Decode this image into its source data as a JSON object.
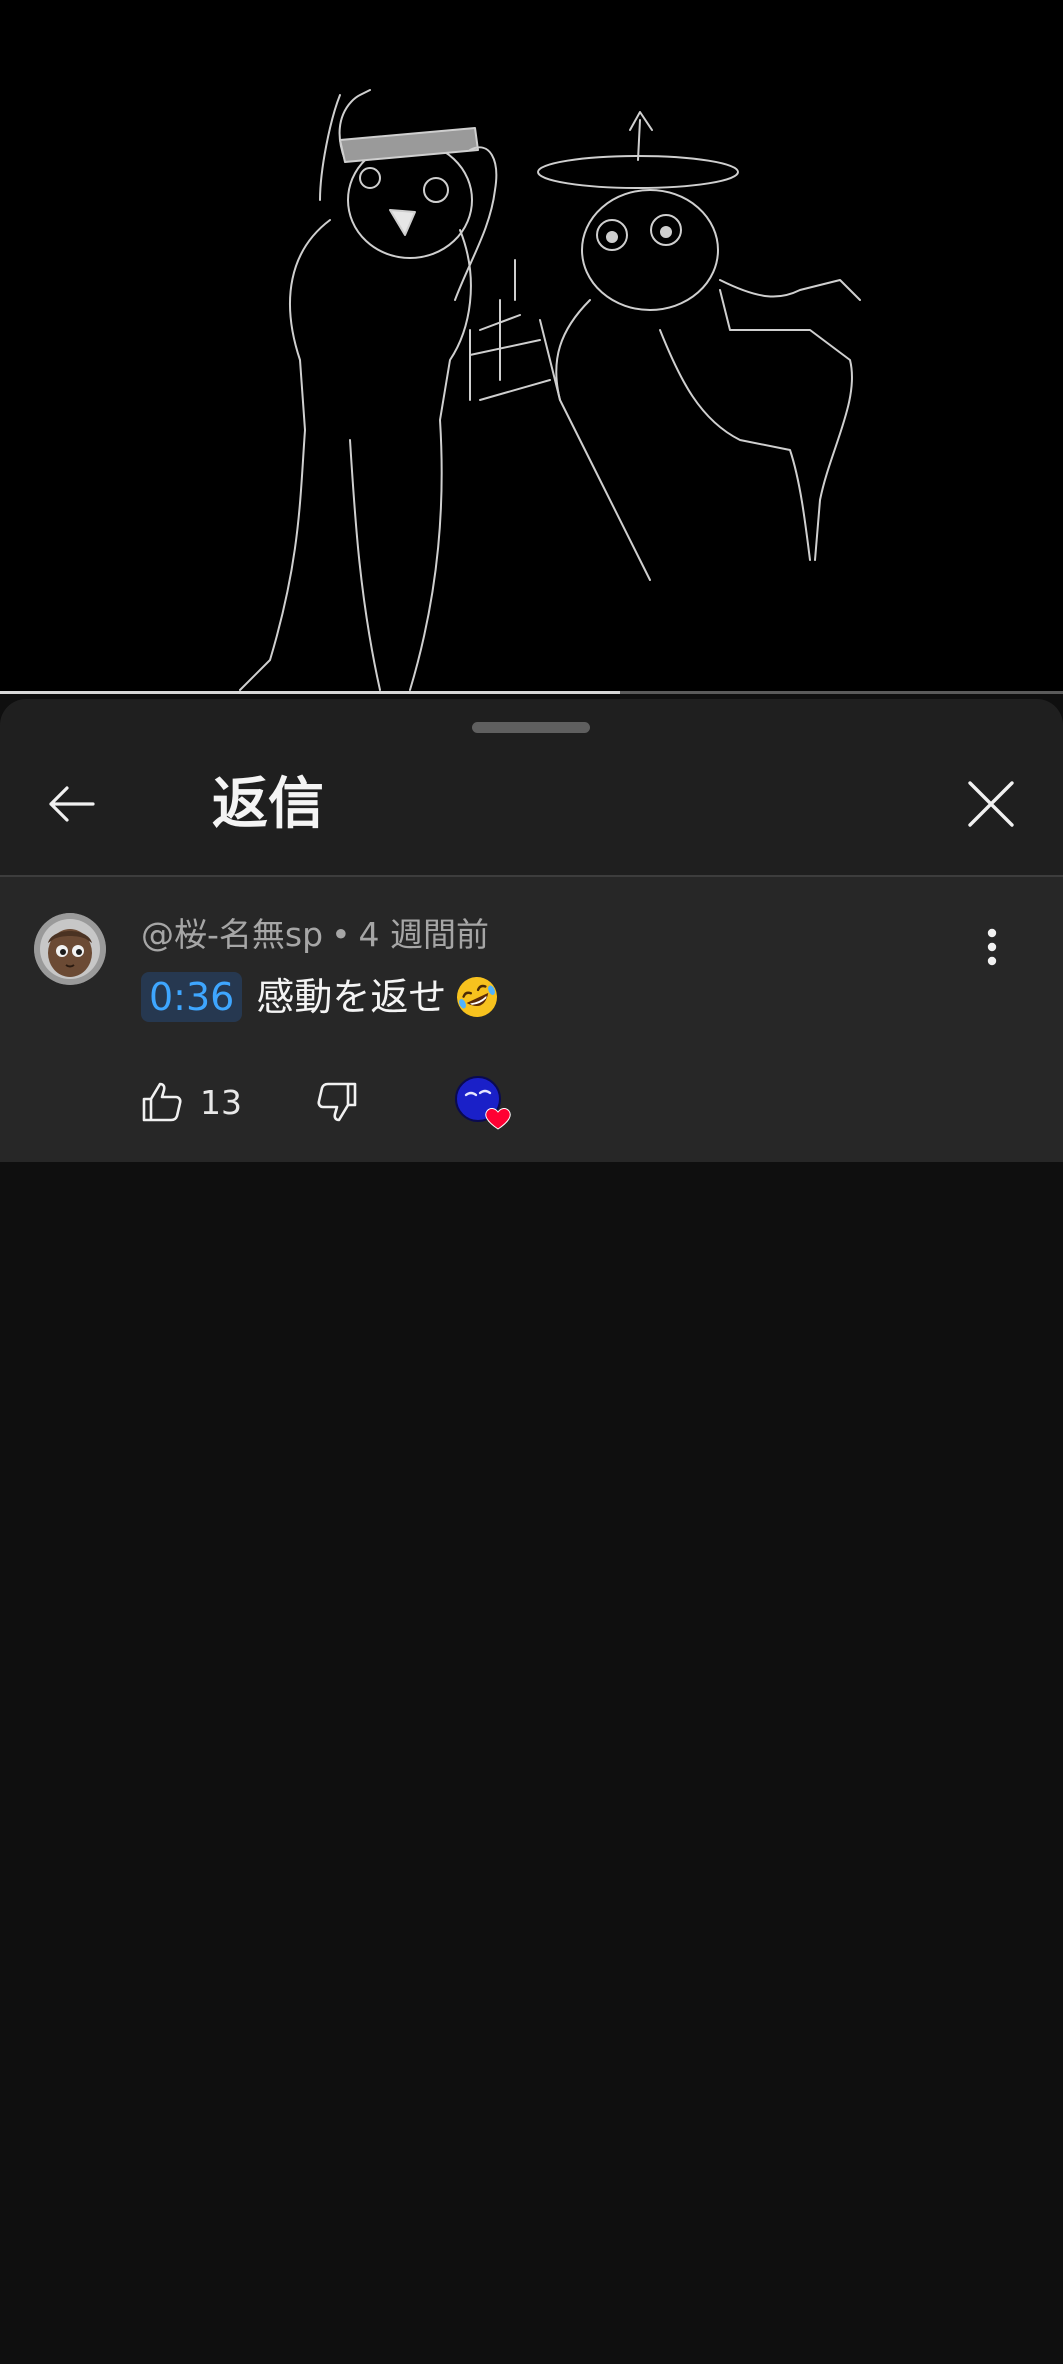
{
  "video": {
    "progress_fraction": 0.583
  },
  "sheet": {
    "title": "返信"
  },
  "comment": {
    "author": "@桜-名無sp",
    "separator": "•",
    "time_ago": "4 週間前",
    "timestamp_link": "0:36",
    "text": "感動を返せ",
    "emoji": "rolling-on-the-floor-laughing-emoji",
    "like_count": "13"
  },
  "icons": {
    "back": "arrow-left-icon",
    "close": "close-icon",
    "more": "more-vert-icon",
    "like": "thumbs-up-icon",
    "dislike": "thumbs-down-icon",
    "heart": "creator-heart-icon"
  },
  "colors": {
    "timestamp_link": "#3ea6ff",
    "heart": "#ff0033"
  }
}
